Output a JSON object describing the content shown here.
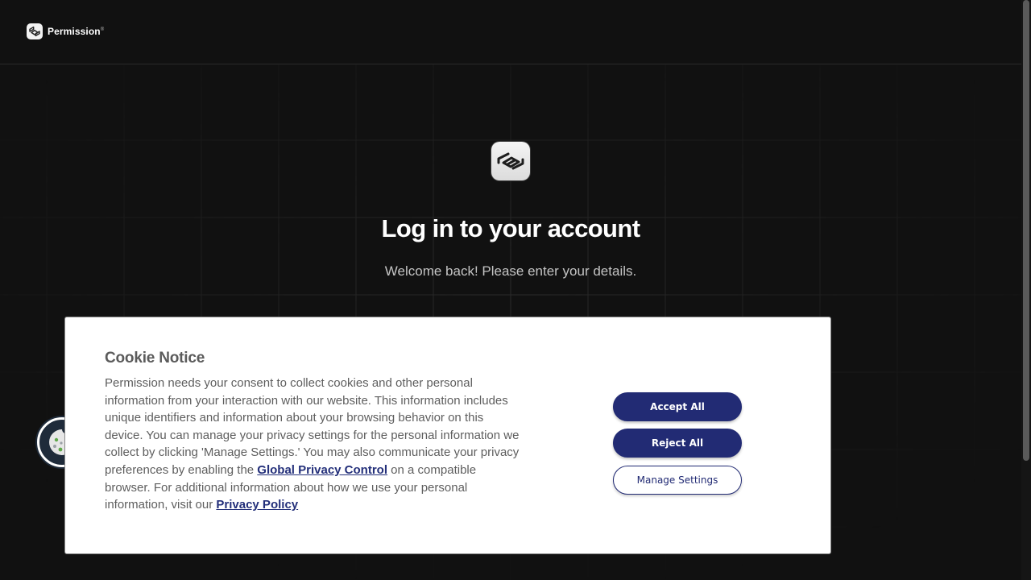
{
  "brand": {
    "name": "Permission",
    "mark": "®",
    "logo_icon": "permission-logo-icon"
  },
  "login": {
    "title": "Log in to your account",
    "subtitle": "Welcome back! Please enter your details."
  },
  "cookie_notice": {
    "title": "Cookie Notice",
    "text_1": "Permission needs your consent to collect cookies and other personal information from your interaction with our website. This information includes unique identifiers and information about your browsing behavior on this device. You can manage your privacy settings for the personal information we collect by clicking 'Manage Settings.' You may also communicate your privacy preferences by enabling the ",
    "link_gpc": "Global Privacy Control",
    "text_2": " on a compatible browser. For additional information about how we use your personal information, visit our ",
    "link_privacy": "Privacy Policy",
    "accept_label": "Accept All",
    "reject_label": "Reject All",
    "manage_label": "Manage Settings"
  },
  "colors": {
    "background": "#111111",
    "accent": "#222b74",
    "banner_text": "#5e5e5e"
  },
  "icons": {
    "cookie_fab": "cookie-icon"
  }
}
